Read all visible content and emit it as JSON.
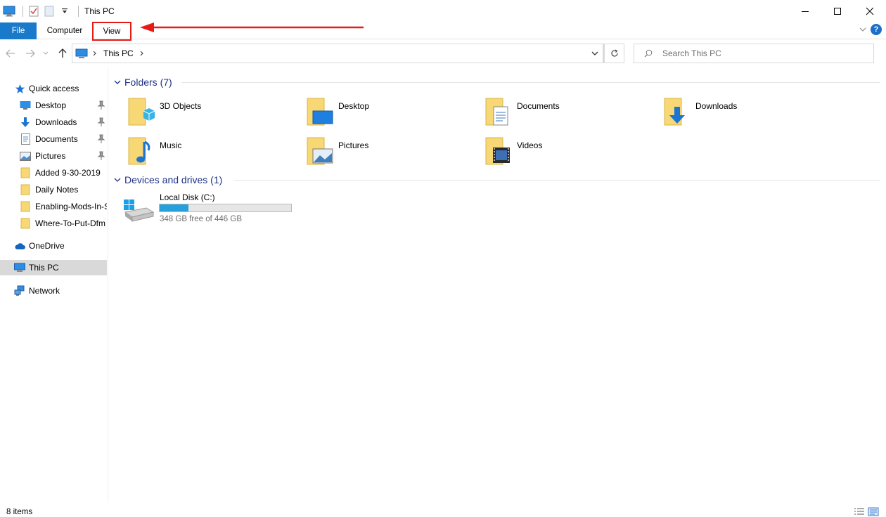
{
  "window": {
    "title": "This PC",
    "controls": [
      "minimize",
      "maximize",
      "close"
    ]
  },
  "ribbon": {
    "tabs": [
      {
        "label": "File"
      },
      {
        "label": "Computer"
      },
      {
        "label": "View"
      }
    ],
    "help_label": "?"
  },
  "address_bar": {
    "breadcrumb": [
      "This PC"
    ],
    "search_placeholder": "Search This PC"
  },
  "sidebar": {
    "quick_access": {
      "label": "Quick access",
      "items": [
        {
          "label": "Desktop",
          "icon": "desktop-folder-icon",
          "pinned": true
        },
        {
          "label": "Downloads",
          "icon": "downloads-icon",
          "pinned": true
        },
        {
          "label": "Documents",
          "icon": "documents-icon",
          "pinned": true
        },
        {
          "label": "Pictures",
          "icon": "pictures-icon",
          "pinned": true
        },
        {
          "label": "Added 9-30-2019",
          "icon": "folder-icon",
          "pinned": false
        },
        {
          "label": "Daily Notes",
          "icon": "folder-icon",
          "pinned": false
        },
        {
          "label": "Enabling-Mods-In-S",
          "icon": "folder-icon",
          "pinned": false
        },
        {
          "label": "Where-To-Put-Dfm",
          "icon": "folder-icon",
          "pinned": false
        }
      ]
    },
    "onedrive": {
      "label": "OneDrive"
    },
    "this_pc": {
      "label": "This PC"
    },
    "network": {
      "label": "Network"
    }
  },
  "content": {
    "folders_header": "Folders (7)",
    "folders": [
      {
        "label": "3D Objects",
        "icon": "3d-objects-folder-icon"
      },
      {
        "label": "Desktop",
        "icon": "desktop-folder-icon"
      },
      {
        "label": "Documents",
        "icon": "documents-folder-icon"
      },
      {
        "label": "Downloads",
        "icon": "downloads-folder-icon"
      },
      {
        "label": "Music",
        "icon": "music-folder-icon"
      },
      {
        "label": "Pictures",
        "icon": "pictures-folder-icon"
      },
      {
        "label": "Videos",
        "icon": "videos-folder-icon"
      }
    ],
    "devices_header": "Devices and drives (1)",
    "drives": [
      {
        "label": "Local Disk (C:)",
        "free_text": "348 GB free of 446 GB",
        "used_fraction": 0.22
      }
    ]
  },
  "status_bar": {
    "item_count": "8 items"
  },
  "colors": {
    "file_tab": "#1979ca",
    "accent_blue": "#26a0da",
    "highlight_red": "#e41b17",
    "group_header": "#1e3287",
    "folder_yellow": "#f8d775"
  }
}
